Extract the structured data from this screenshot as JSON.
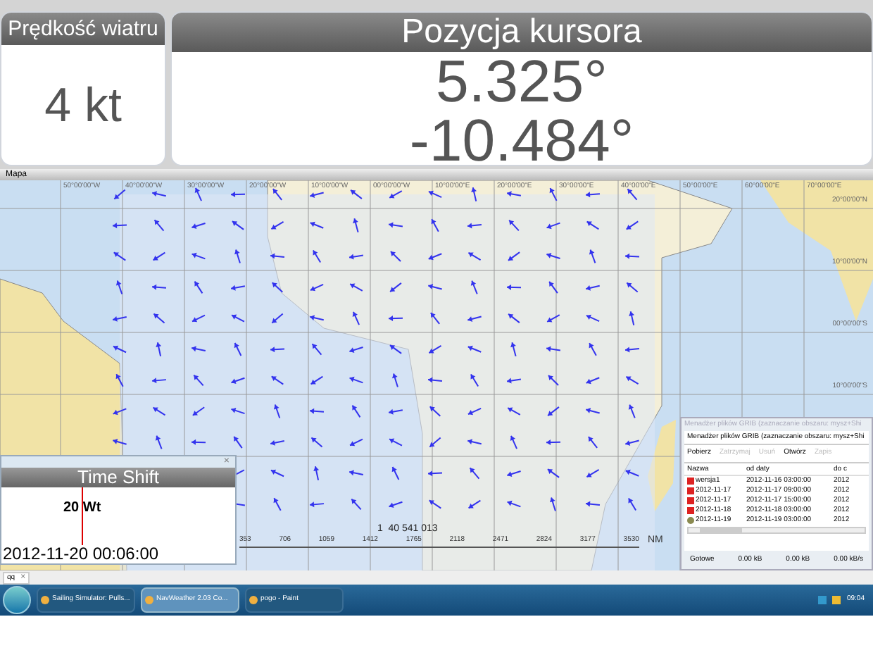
{
  "instruments": [
    {
      "title": "Prędkość wiatru",
      "values": [
        "4 kt"
      ]
    },
    {
      "title": "Pozycja kursora",
      "values": [
        "5.325°",
        "-10.484°"
      ]
    }
  ],
  "map": {
    "title": "Mapa",
    "lon_labels": [
      "50°00'00\"W",
      "40°00'00\"W",
      "30°00'00\"W",
      "20°00'00\"W",
      "10°00'00\"W",
      "00°00'00\"W",
      "10°00'00\"E",
      "20°00'00\"E",
      "30°00'00\"E",
      "40°00'00\"E",
      "50°00'00\"E",
      "60°00'00\"E",
      "70°00'00\"E"
    ],
    "lat_labels": [
      "20°00'00\"N",
      "10°00'00\"N",
      "00°00'00\"S",
      "10°00'00\"S"
    ],
    "scale": {
      "ratio": "1  40 541 013",
      "ticks": [
        "353",
        "706",
        "1059",
        "1412",
        "1765",
        "2118",
        "2471",
        "2824",
        "3177",
        "3530"
      ],
      "unit": "NM"
    }
  },
  "time_shift": {
    "title": "Time Shift",
    "close": "×",
    "wind": "20 Wt",
    "datetime": "2012-11-20 00:06:00"
  },
  "grib_manager": {
    "window_title": "Menadżer plików GRIB (zaznaczanie obszaru: mysz+Shi",
    "heading": "Menadżer plików GRIB (zaznaczanie obszaru: mysz+Shi",
    "toolbar": [
      {
        "label": "Pobierz",
        "disabled": false
      },
      {
        "label": "Zatrzymaj",
        "disabled": true
      },
      {
        "label": "Usuń",
        "disabled": true
      },
      {
        "label": "Otwórz",
        "disabled": false
      },
      {
        "label": "Zapis",
        "disabled": true
      }
    ],
    "columns": [
      "Nazwa",
      "od daty",
      "do c"
    ],
    "rows": [
      {
        "kind": "error",
        "cells": [
          "wersja1",
          "2012-11-16 03:00:00",
          "2012"
        ]
      },
      {
        "kind": "error",
        "cells": [
          "2012-11-17",
          "2012-11-17 09:00:00",
          "2012"
        ]
      },
      {
        "kind": "error",
        "cells": [
          "2012-11-17",
          "2012-11-17 15:00:00",
          "2012"
        ]
      },
      {
        "kind": "error",
        "cells": [
          "2012-11-18",
          "2012-11-18 03:00:00",
          "2012"
        ]
      },
      {
        "kind": "ok",
        "cells": [
          "2012-11-19",
          "2012-11-19 03:00:00",
          "2012"
        ]
      }
    ],
    "status": [
      "Gotowe",
      "0.00 kB",
      "0.00 kB",
      "0.00 kB/s"
    ]
  },
  "bottom_tab": {
    "label": "qq",
    "close": "×"
  },
  "taskbar": {
    "items": [
      {
        "label": "Sailing Simulator: Pulls...",
        "selected": false
      },
      {
        "label": "NavWeather 2.03 Co...",
        "selected": true
      },
      {
        "label": "pogo - Paint",
        "selected": false
      }
    ],
    "clock": "09:04"
  }
}
